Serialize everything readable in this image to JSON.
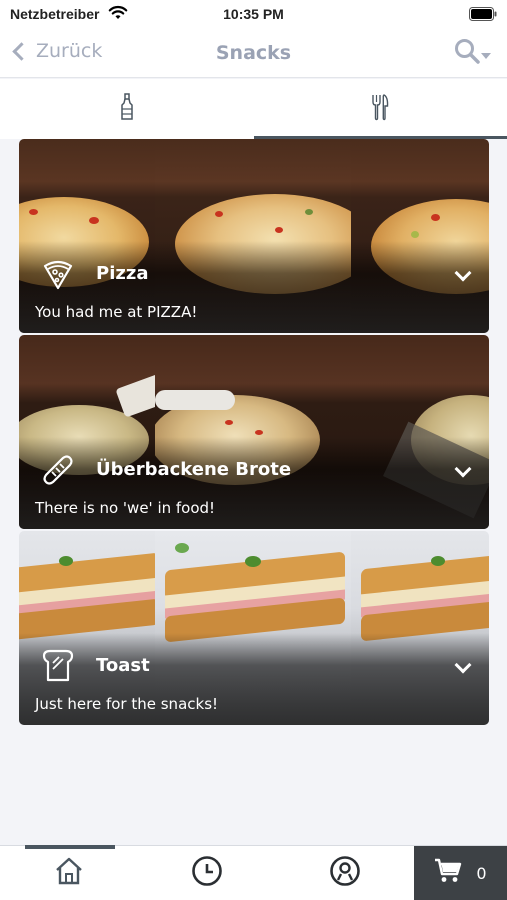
{
  "status": {
    "carrier": "Netzbetreiber",
    "time": "10:35 PM"
  },
  "nav": {
    "back_label": "Zurück",
    "title": "Snacks"
  },
  "tabs": [
    {
      "name": "drinks",
      "icon": "bottle-icon",
      "active": false
    },
    {
      "name": "food",
      "icon": "cutlery-icon",
      "active": true
    }
  ],
  "categories": [
    {
      "name": "Pizza",
      "tagline": "You had me at PIZZA!",
      "icon": "pizza-slice-icon"
    },
    {
      "name": "Überbackene Brote",
      "tagline": "There is no 'we' in food!",
      "icon": "baguette-icon"
    },
    {
      "name": "Toast",
      "tagline": "Just here for the snacks!",
      "icon": "toast-icon"
    }
  ],
  "bottom_bar": {
    "items": [
      {
        "name": "home",
        "icon": "home-icon",
        "active": true
      },
      {
        "name": "orders",
        "icon": "clock-icon",
        "active": false
      },
      {
        "name": "account",
        "icon": "user-icon",
        "active": false
      }
    ],
    "cart_count": "0"
  }
}
